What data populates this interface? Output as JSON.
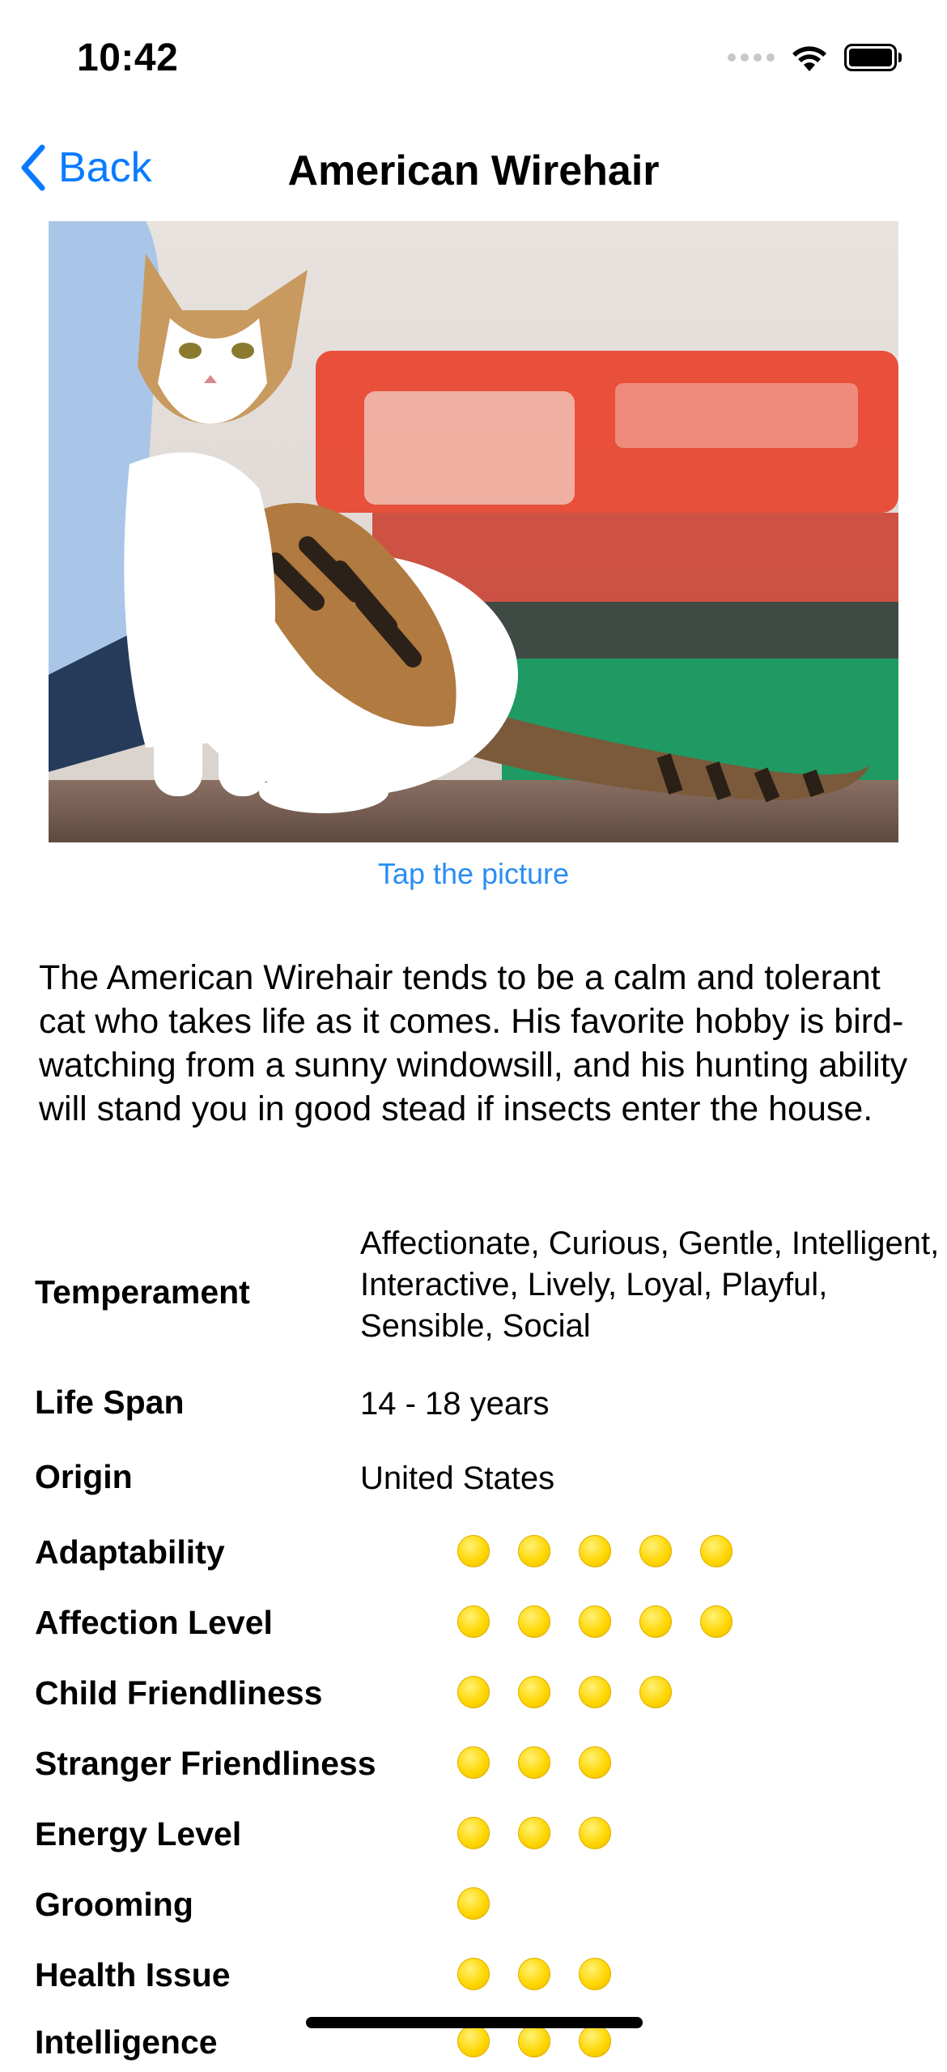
{
  "status": {
    "time": "10:42"
  },
  "nav": {
    "back_label": "Back",
    "title": "American Wirehair"
  },
  "photo": {
    "caption": "Tap the picture"
  },
  "description": "The American Wirehair tends to be a calm and tolerant cat who takes life as it comes. His favorite hobby is bird-watching from a sunny windowsill, and his hunting ability will stand you in good stead if insects enter the house.",
  "info": {
    "temperament_label": "Temperament",
    "temperament_value": "Affectionate, Curious, Gentle, Intelligent, Interactive, Lively, Loyal, Playful, Sensible, Social",
    "lifespan_label": "Life Span",
    "lifespan_value": "14 - 18 years",
    "origin_label": "Origin",
    "origin_value": "United States"
  },
  "ratings": [
    {
      "label": "Adaptability",
      "value": 5
    },
    {
      "label": "Affection Level",
      "value": 5
    },
    {
      "label": "Child Friendliness",
      "value": 4
    },
    {
      "label": "Stranger Friendliness",
      "value": 3
    },
    {
      "label": "Energy Level",
      "value": 3
    },
    {
      "label": "Grooming",
      "value": 1
    },
    {
      "label": "Health Issue",
      "value": 3
    },
    {
      "label": "Intelligence",
      "value": 3
    }
  ],
  "colors": {
    "accent": "#0a7bff",
    "link": "#2b8ef2",
    "rating_dot": "#ffd600"
  }
}
